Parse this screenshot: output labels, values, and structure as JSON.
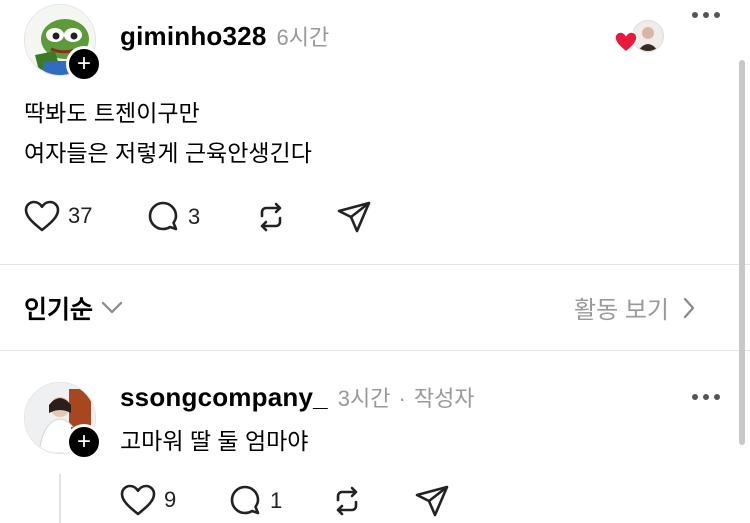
{
  "post": {
    "username": "giminho328",
    "time": "6시간",
    "text_line1": "딱봐도 트젠이구만",
    "text_line2": "여자들은 저렇게 근육안생긴다",
    "likes": "37",
    "replies": "3"
  },
  "sort": {
    "label": "인기순",
    "activity_label": "활동 보기"
  },
  "reply": {
    "username": "ssongcompany_",
    "time": "3시간",
    "separator": "·",
    "author_badge": "작성자",
    "text": "고마워 딸 둘 엄마야",
    "likes": "9",
    "replies": "1"
  },
  "colors": {
    "heart_red": "#e8193c",
    "meta_gray": "#999999",
    "divider": "#e3e3e3"
  },
  "icons": [
    "heart-icon",
    "comment-icon",
    "repost-icon",
    "share-icon",
    "more-icon",
    "chevron-down-icon",
    "chevron-right-icon",
    "follow-plus-icon"
  ]
}
